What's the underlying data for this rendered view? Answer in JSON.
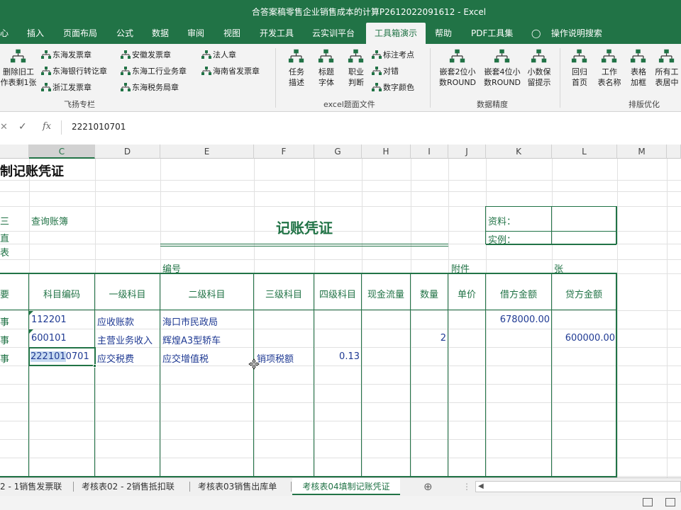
{
  "window": {
    "title": "合答案稿零售企业销售成本的计算P2612022091612  -  Excel"
  },
  "menu": {
    "tabs": [
      "心",
      "插入",
      "页面布局",
      "公式",
      "数据",
      "审阅",
      "视图",
      "开发工具",
      "云实训平台",
      "工具箱演示",
      "帮助",
      "PDF工具集"
    ],
    "active": "工具箱演示",
    "tell_me": "操作说明搜索"
  },
  "ribbon": {
    "group1": {
      "label": "飞扬专栏",
      "big_button": [
        "删除旧工",
        "作表剩1张"
      ],
      "items": [
        "东海发票章",
        "安徽发票章",
        "法人章",
        "东海银行转讫章",
        "东海工行业务章",
        "海南省发票章",
        "浙江发票章",
        "东海税务局章"
      ]
    },
    "group2": {
      "label": "excel题面文件",
      "big_buttons": [
        [
          "任务",
          "描述"
        ],
        [
          "标题",
          "字体"
        ],
        [
          "职业",
          "判断"
        ]
      ],
      "items": [
        "标注考点",
        "对错",
        "数字颜色"
      ]
    },
    "group3": {
      "label": "数据精度",
      "big_buttons": [
        [
          "嵌套2位小",
          "数ROUND"
        ],
        [
          "嵌套4位小",
          "数ROUND"
        ],
        [
          "小数保",
          "留提示"
        ]
      ]
    },
    "group4": {
      "label": "排版优化",
      "big_buttons": [
        [
          "回归",
          "首页"
        ],
        [
          "工作",
          "表名称"
        ],
        [
          "表格",
          "加框"
        ],
        [
          "所有工",
          "表居中"
        ]
      ]
    }
  },
  "formula_bar": {
    "value": "2221010701"
  },
  "columns": [
    "C",
    "D",
    "E",
    "F",
    "G",
    "H",
    "I",
    "J",
    "K",
    "L",
    "M"
  ],
  "selected_column": "C",
  "sheet": {
    "top_title": "制记账凭证",
    "label_query": "查询账簿",
    "voucher_title": "记账凭证",
    "info_box": {
      "row1": "资料：",
      "row2": "实例："
    },
    "number_label": "编号",
    "attachment_label": "附件",
    "sheet_unit": "张",
    "left_cut": [
      "三",
      "直",
      "表"
    ],
    "headers": [
      "要",
      "科目编码",
      "一级科目",
      "二级科目",
      "三级科目",
      "四级科目",
      "现金流量",
      "数量",
      "单价",
      "借方金额",
      "贷方金额"
    ],
    "rows": [
      {
        "lead": "事",
        "code": "112201",
        "l1": "应收账款",
        "l2": "海口市民政局",
        "l3": "",
        "l4": "",
        "qty": "",
        "debit": "678000.00",
        "credit": ""
      },
      {
        "lead": "事",
        "code": "600101",
        "l1": "主营业务收入",
        "l2": "辉煌A3型轿车",
        "l3": "",
        "l4": "",
        "qty": "2",
        "debit": "",
        "credit": "600000.00"
      },
      {
        "lead": "事",
        "code": "2221010701",
        "code_sel": "222101",
        "code_rest": "0701",
        "l1": "应交税费",
        "l2": "应交增值税",
        "l3": "销项税额",
        "l4": "0.13",
        "qty": "",
        "debit": "",
        "credit": ""
      }
    ]
  },
  "sheet_tabs": [
    "2 - 1销售发票联",
    "考核表02 - 2销售抵扣联",
    "考核表03销售出库单",
    "考核表04填制记账凭证"
  ],
  "active_sheet": "考核表04填制记账凭证",
  "colors": {
    "excel_green": "#217346",
    "data_blue": "#1f3a93"
  }
}
